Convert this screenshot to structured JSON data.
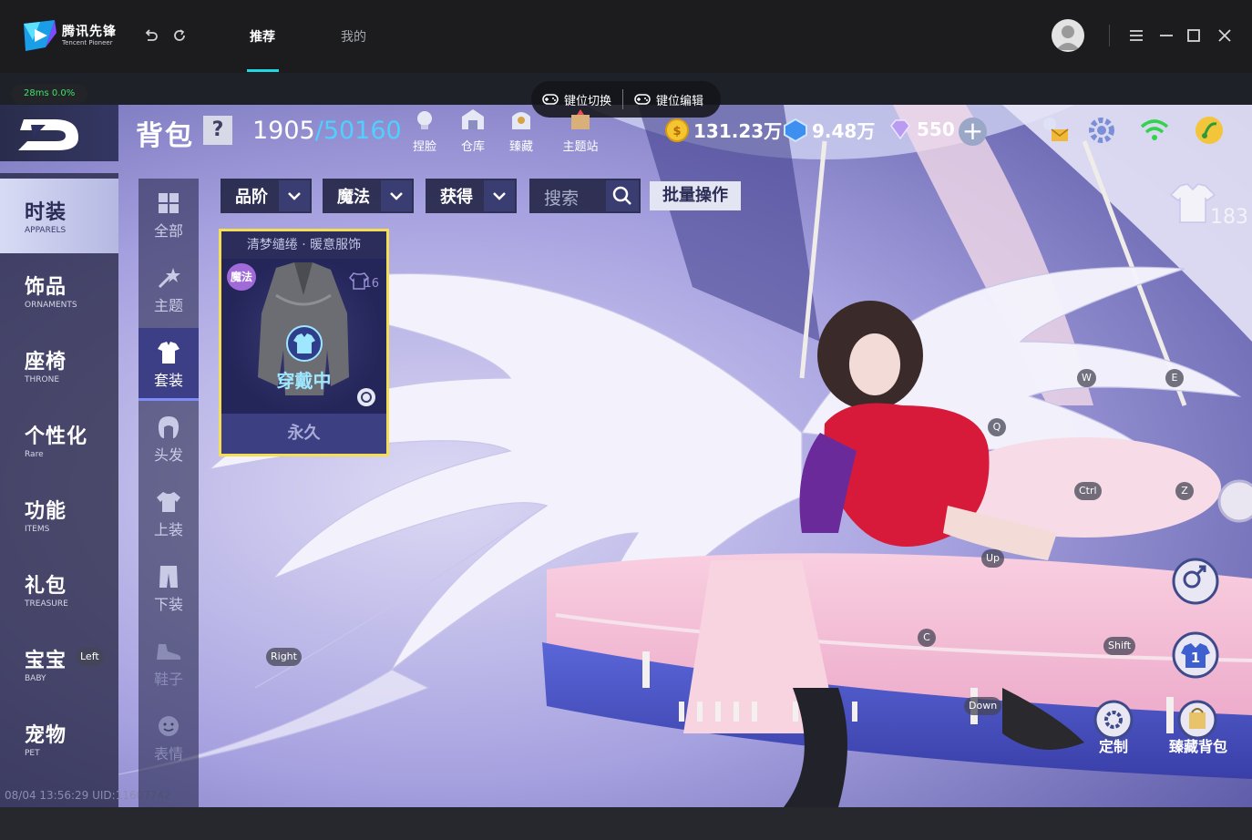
{
  "launcher": {
    "brand_cn": "腾讯先锋",
    "brand_en": "Tencent Pioneer",
    "tabs": [
      "推荐",
      "我的"
    ],
    "active_tab": 0
  },
  "overlay": {
    "latency": "28ms  0.0%",
    "key_switch": "键位切换",
    "key_edit": "键位编辑"
  },
  "game": {
    "header": {
      "title": "背包",
      "help": "?",
      "count": "1905",
      "capacity": "/50160",
      "shortcuts": [
        "捏脸",
        "仓库",
        "臻藏",
        "主题站"
      ]
    },
    "currency": {
      "coins": "131.23万",
      "coupons": "9.48万",
      "diamonds": "550"
    },
    "categories": [
      {
        "cn": "时装",
        "en": "APPARELS"
      },
      {
        "cn": "饰品",
        "en": "ORNAMENTS"
      },
      {
        "cn": "座椅",
        "en": "THRONE"
      },
      {
        "cn": "个性化",
        "en": "Rare"
      },
      {
        "cn": "功能",
        "en": "ITEMS"
      },
      {
        "cn": "礼包",
        "en": "TREASURE"
      },
      {
        "cn": "宝宝",
        "en": "BABY"
      },
      {
        "cn": "宠物",
        "en": "PET"
      }
    ],
    "subcategories": [
      "全部",
      "主题",
      "套装",
      "头发",
      "上装",
      "下装",
      "鞋子",
      "表情"
    ],
    "filters": [
      "品阶",
      "魔法",
      "获得"
    ],
    "search_placeholder": "搜索",
    "batch_button": "批量操作",
    "item": {
      "name": "清梦缱绻 · 暖意服饰",
      "tag": "魔法",
      "level": "16",
      "status": "穿戴中",
      "duration": "永久"
    },
    "outfit_count": "183",
    "key_hints": [
      "W",
      "E",
      "Q",
      "Ctrl",
      "Z",
      "Up",
      "C",
      "Shift",
      "Down",
      "Left",
      "Right"
    ],
    "side_buttons": {
      "customize": "定制",
      "collection_bag": "臻藏背包"
    },
    "footer": "08/04 13:56:29 UID:11607742"
  },
  "colors": {
    "accent": "#1fd8e6",
    "selected_card_border": "#f4de53",
    "latency_text": "#3ce26b",
    "capacity_text": "#4ed1ff"
  }
}
